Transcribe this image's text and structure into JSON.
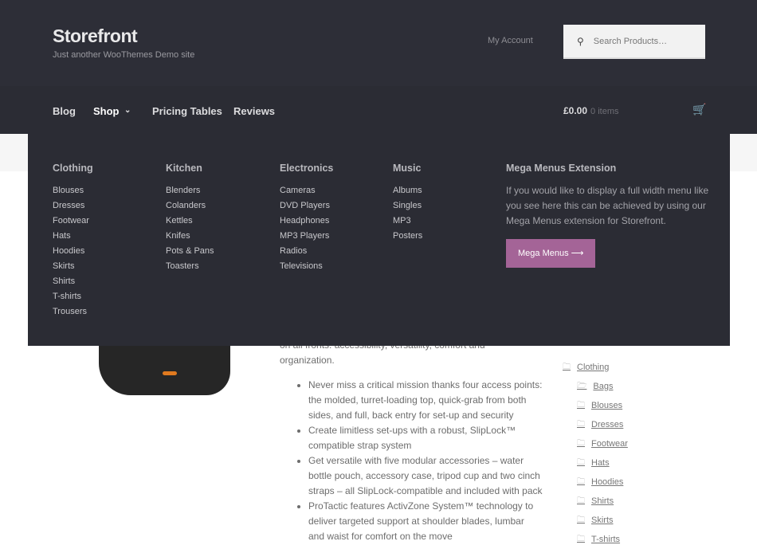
{
  "header": {
    "site_title": "Storefront",
    "tagline": "Just another WooThemes Demo site",
    "my_account": "My Account",
    "search_placeholder": "Search Products…"
  },
  "nav": {
    "items": [
      "Blog",
      "Shop",
      "Pricing Tables",
      "Reviews"
    ],
    "cart_total": "£0.00",
    "cart_count": "0 items"
  },
  "mega": {
    "columns": [
      {
        "title": "Clothing",
        "items": [
          "Blouses",
          "Dresses",
          "Footwear",
          "Hats",
          "Hoodies",
          "Skirts",
          "Shirts",
          "T-shirts",
          "Trousers"
        ]
      },
      {
        "title": "Kitchen",
        "items": [
          "Blenders",
          "Colanders",
          "Kettles",
          "Knifes",
          "Pots & Pans",
          "Toasters"
        ]
      },
      {
        "title": "Electronics",
        "items": [
          "Cameras",
          "DVD Players",
          "Headphones",
          "MP3 Players",
          "Radios",
          "Televisions"
        ]
      },
      {
        "title": "Music",
        "items": [
          "Albums",
          "Singles",
          "MP3",
          "Posters"
        ]
      }
    ],
    "extension_title": "Mega Menus Extension",
    "extension_text": "If you would like to display a full width menu like you see here this can be achieved by using our Mega Menus extension for Storefront.",
    "button": "Mega Menus ⟶"
  },
  "product": {
    "intro_partial": "on all fronts: accessibility, versatility, comfort and",
    "intro_end": "organization.",
    "bullets": [
      "Never miss a critical mission thanks four access points: the molded, turret-loading top, quick-grab from both sides, and full, back entry for set-up and security",
      "Create limitless set-ups with a robust, SlipLock™ compatible strap system",
      "Get versatile with five modular accessories – water bottle pouch, accessory case, tripod cup and two cinch straps – all SlipLock-compatible and included with pack",
      "ProTactic features ActivZone System™ technology to deliver targeted support at shoulder blades, lumbar and waist for comfort on the move"
    ]
  },
  "categories": {
    "parent": "Clothing",
    "children": [
      "Bags",
      "Blouses",
      "Dresses",
      "Footwear",
      "Hats",
      "Hoodies",
      "Shirts",
      "Skirts",
      "T-shirts"
    ]
  }
}
